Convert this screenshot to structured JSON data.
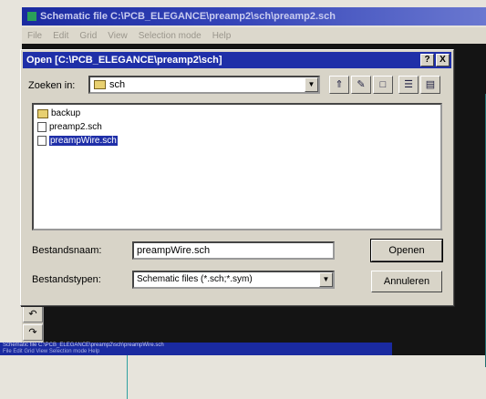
{
  "app": {
    "title": "Schematic file C:\\PCB_ELEGANCE\\preamp2\\sch\\preamp2.sch",
    "menu": [
      "File",
      "Edit",
      "Grid",
      "View",
      "Selection mode",
      "Help"
    ]
  },
  "dialog": {
    "title": "Open [C:\\PCB_ELEGANCE\\preamp2\\sch]",
    "help_btn": "?",
    "close_btn": "X",
    "lookin_label": "Zoeken in:",
    "lookin_value": "sch",
    "files": [
      {
        "name": "backup",
        "type": "folder",
        "selected": false
      },
      {
        "name": "preamp2.sch",
        "type": "file",
        "selected": false
      },
      {
        "name": "preampWire.sch",
        "type": "file",
        "selected": true
      }
    ],
    "filename_label": "Bestandsnaam:",
    "filename_value": "preampWire.sch",
    "filetype_label": "Bestandstypen:",
    "filetype_value": "Schematic files (*.sch;*.sym)",
    "open_button": "Openen",
    "cancel_button": "Annuleren"
  },
  "taskbar": {
    "line1": "Schematic file C:\\PCB_ELEGANCE\\preamp2\\sch\\preampWire.sch",
    "line2": "File  Edit  Grid  View  Selection mode  Help"
  },
  "colors": {
    "titlebar": "#1f2fa8",
    "dialog_bg": "#d8d4c8",
    "canvas": "#141414"
  }
}
